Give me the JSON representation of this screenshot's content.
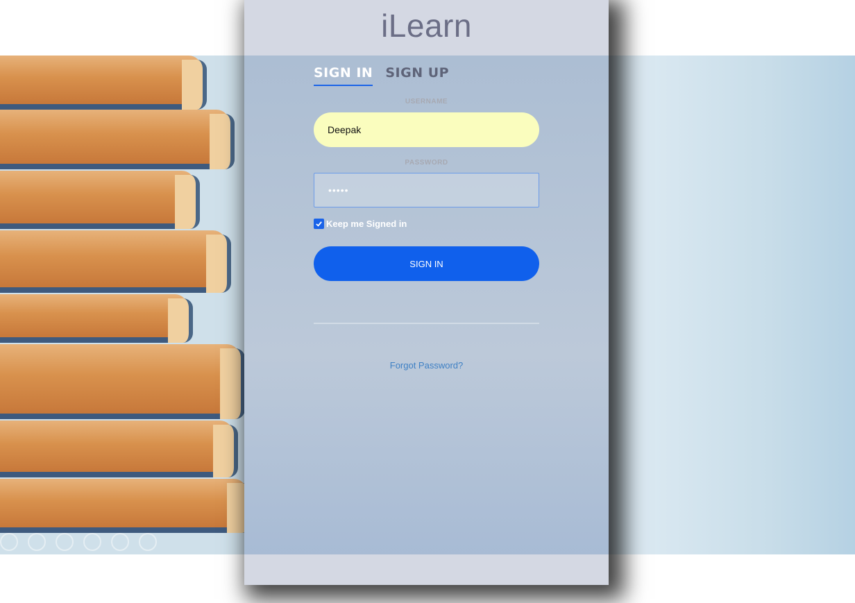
{
  "app": {
    "title": "iLearn"
  },
  "tabs": [
    {
      "label": "SIGN IN",
      "active": true
    },
    {
      "label": "SIGN UP",
      "active": false
    }
  ],
  "form": {
    "username_label": "USERNAME",
    "username_value": "Deepak",
    "password_label": "PASSWORD",
    "password_value": "•••••",
    "keep_signed_in_label": "Keep me Signed in",
    "keep_signed_in_checked": true,
    "submit_label": "SIGN IN",
    "forgot_label": "Forgot Password?"
  },
  "colors": {
    "accent": "#1060ec",
    "username_bg": "#fafdbe",
    "link": "#3d7fc4",
    "brand_text": "#6b6e86"
  },
  "background": {
    "image": "stack-of-books-photo",
    "slide_controls": [
      "play-icon",
      "pen-icon",
      "slides-icon",
      "zoom-icon",
      "more-icon"
    ]
  }
}
